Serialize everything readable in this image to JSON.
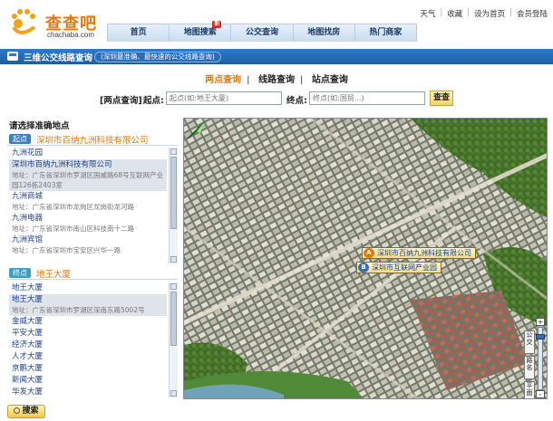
{
  "brand": {
    "name": "查查吧",
    "domain": "chachaba.com",
    "accent": "#e07a10"
  },
  "utility_links": [
    "天气",
    "收藏",
    "设为首页",
    "会员登陆"
  ],
  "nav": {
    "items": [
      {
        "label": "首页",
        "badge": ""
      },
      {
        "label": "地图搜索",
        "badge": "新"
      },
      {
        "label": "公交查询",
        "badge": ""
      },
      {
        "label": "地图找房",
        "badge": ""
      },
      {
        "label": "热门商家",
        "badge": ""
      }
    ]
  },
  "section": {
    "title": "三维公交线路查询",
    "subtitle": "(深圳最准确、最快速的公交线路查询)"
  },
  "modes": {
    "items": [
      "两点查询",
      "线路查询",
      "站点查询"
    ],
    "active_index": 0
  },
  "search": {
    "bracket_label": "[两点查询]",
    "start_label": "起点:",
    "start_placeholder": "起点(如:地王大厦)",
    "end_label": "终点:",
    "end_placeholder": "终点(如:国贸...)",
    "submit_label": "查查"
  },
  "left": {
    "title": "请选择准确地点",
    "start_group": {
      "tag": "起点",
      "name": "深圳市百纳九洲科技有限公司",
      "items": [
        {
          "name": "九洲花园",
          "address": "",
          "selected": false
        },
        {
          "name": "深圳市百纳九洲科技有限公司",
          "address": "地址：广东省深圳市罗湖区国威路68号互联网产业园126栋2403室",
          "selected": true
        },
        {
          "name": "九洲商城",
          "address": "地址：广东省深圳市龙岗区龙岗街龙河路",
          "selected": false
        },
        {
          "name": "九洲电器",
          "address": "地址：广东省深圳市南山区科技南十二路",
          "selected": false
        },
        {
          "name": "九洲宾馆",
          "address": "地址：广东省深圳市宝安区兴华一路",
          "selected": false
        }
      ]
    },
    "end_group": {
      "tag": "终点",
      "name": "地王大厦",
      "items": [
        {
          "name": "地王大厦",
          "address": "",
          "selected": false
        },
        {
          "name": "地王大厦",
          "address": "地址：广东省深圳市罗湖区深南东路5002号",
          "selected": true
        },
        {
          "name": "金威大厦",
          "address": "",
          "selected": false
        },
        {
          "name": "平安大厦",
          "address": "",
          "selected": false
        },
        {
          "name": "经济大厦",
          "address": "",
          "selected": false
        },
        {
          "name": "人才大厦",
          "address": "",
          "selected": false
        },
        {
          "name": "京鹏大厦",
          "address": "",
          "selected": false
        },
        {
          "name": "新闻大厦",
          "address": "",
          "selected": false
        },
        {
          "name": "华发大厦",
          "address": "",
          "selected": false
        }
      ]
    },
    "search_button": "搜索"
  },
  "map": {
    "markers": [
      {
        "pin": "A",
        "label": "深圳市百纳九洲科技有限公司",
        "color": "#e07a10"
      },
      {
        "pin": "B",
        "label": "深圳市互联网产业园",
        "color": "#2f6fc0"
      }
    ],
    "side_tabs": [
      "公交",
      "路名",
      "平面"
    ],
    "zoom_plus": "+",
    "zoom_minus": "-"
  }
}
